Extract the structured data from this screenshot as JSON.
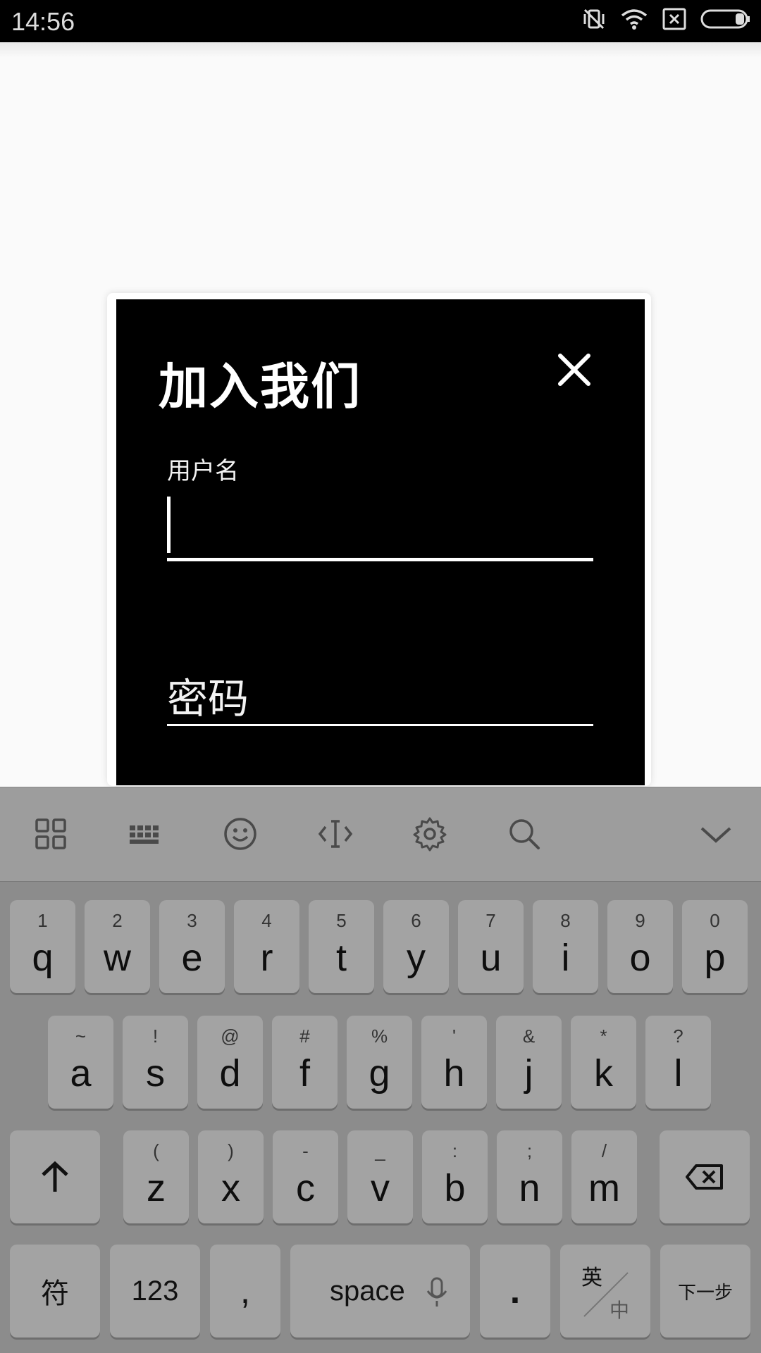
{
  "status_bar": {
    "time": "14:56"
  },
  "dialog": {
    "title": "加入我们",
    "username_label": "用户名",
    "username_value": "",
    "password_label": "密码"
  },
  "keyboard": {
    "toolbar_icons": [
      "apps-grid-icon",
      "keyboard-icon",
      "emoji-icon",
      "cursor-icon",
      "settings-icon",
      "search-icon",
      "collapse-icon"
    ],
    "row1": [
      {
        "main": "q",
        "sub": "1"
      },
      {
        "main": "w",
        "sub": "2"
      },
      {
        "main": "e",
        "sub": "3"
      },
      {
        "main": "r",
        "sub": "4"
      },
      {
        "main": "t",
        "sub": "5"
      },
      {
        "main": "y",
        "sub": "6"
      },
      {
        "main": "u",
        "sub": "7"
      },
      {
        "main": "i",
        "sub": "8"
      },
      {
        "main": "o",
        "sub": "9"
      },
      {
        "main": "p",
        "sub": "0"
      }
    ],
    "row2": [
      {
        "main": "a",
        "sub": "~"
      },
      {
        "main": "s",
        "sub": "!"
      },
      {
        "main": "d",
        "sub": "@"
      },
      {
        "main": "f",
        "sub": "#"
      },
      {
        "main": "g",
        "sub": "%"
      },
      {
        "main": "h",
        "sub": "'"
      },
      {
        "main": "j",
        "sub": "&"
      },
      {
        "main": "k",
        "sub": "*"
      },
      {
        "main": "l",
        "sub": "?"
      }
    ],
    "row3": [
      {
        "main": "z",
        "sub": "("
      },
      {
        "main": "x",
        "sub": ")"
      },
      {
        "main": "c",
        "sub": "-"
      },
      {
        "main": "v",
        "sub": "_"
      },
      {
        "main": "b",
        "sub": ":"
      },
      {
        "main": "n",
        "sub": ";"
      },
      {
        "main": "m",
        "sub": "/"
      }
    ],
    "symbols_label": "符",
    "numbers_label": "123",
    "comma_label": ",",
    "space_label": "space",
    "period_label": ".",
    "lang_top": "英",
    "lang_bottom": "中",
    "next_label": "下一步"
  }
}
